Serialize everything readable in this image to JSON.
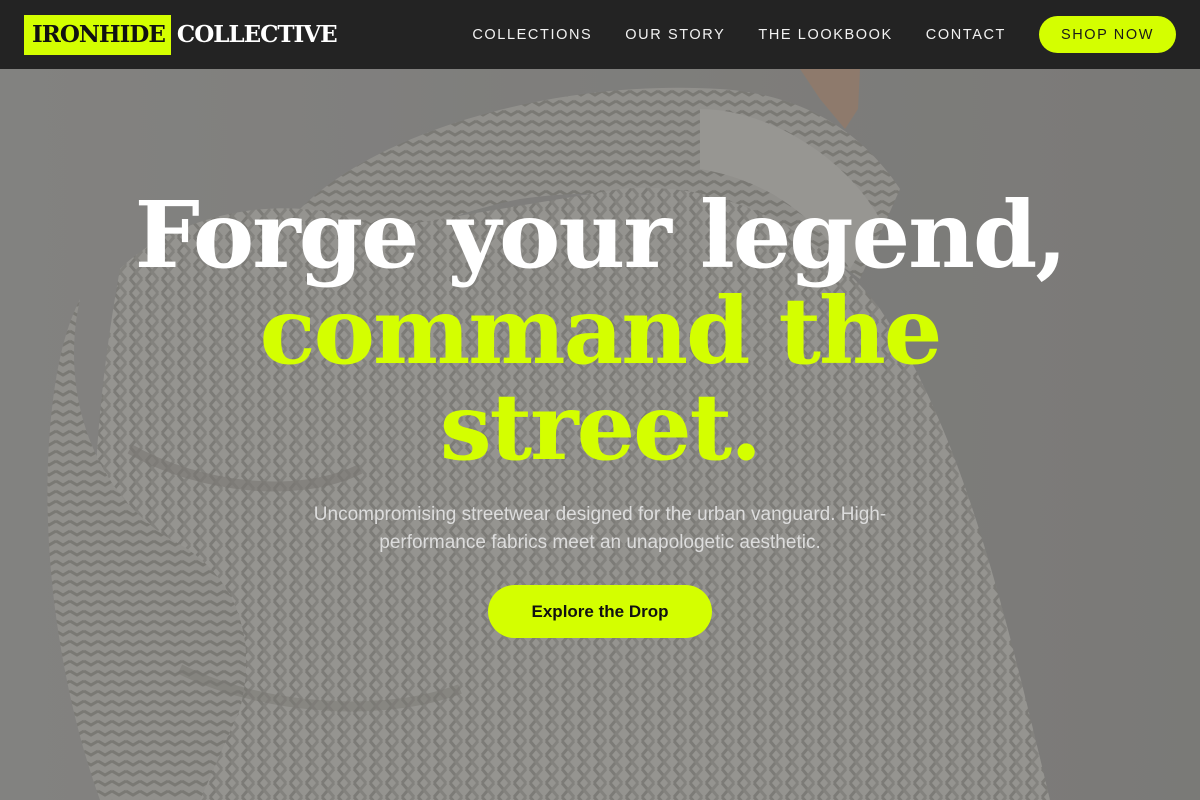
{
  "brand": {
    "logo_highlight": "IRONHIDE",
    "logo_rest": "COLLECTIVE",
    "accent_color": "#d4ff00",
    "nav_bg_color": "#232323"
  },
  "nav": {
    "links": [
      {
        "label": "COLLECTIONS"
      },
      {
        "label": "OUR STORY"
      },
      {
        "label": "THE LOOKBOOK"
      },
      {
        "label": "CONTACT"
      }
    ],
    "cta_label": "SHOP NOW"
  },
  "hero": {
    "background_image": "person-in-chunky-knit-sweater-photo",
    "headline_line1": "Forge your legend,",
    "headline_line2": "command the",
    "headline_line3": "street.",
    "subtitle": "Uncompromising streetwear designed for the urban vanguard. High-performance fabrics meet an unapologetic aesthetic.",
    "cta_label": "Explore the Drop"
  }
}
